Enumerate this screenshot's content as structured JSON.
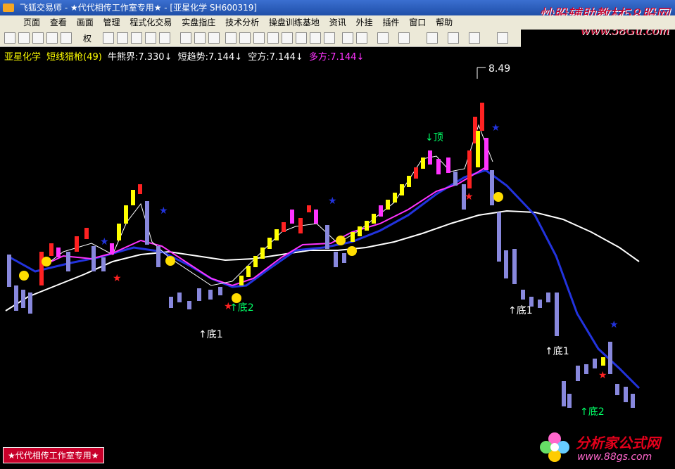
{
  "titlebar": {
    "text": "飞狐交易师 - ★代代相传工作室专用★ - [亚星化学 SH600319]"
  },
  "watermark": {
    "top": "炒股辅助教材58股网",
    "url": "www.58Gu.com"
  },
  "menu": [
    "页面",
    "查看",
    "画面",
    "管理",
    "程式化交易",
    "实盘指庄",
    "技术分析",
    "操盘训练基地",
    "资讯",
    "外挂",
    "插件",
    "窗口",
    "帮助"
  ],
  "toolbar": {
    "rights_label": "权"
  },
  "info": {
    "stock_name": "亚星化学",
    "indicator": "短线猎枪(49)",
    "bull_bear": "牛熊界:7.330↓",
    "short_trend": "短趋势:7.144↓",
    "kong": "空方:7.144↓",
    "duo": "多方:7.144↓"
  },
  "annotations": {
    "peak": "8.49",
    "top": "↓顶",
    "di1a": "↑底1",
    "di2a": "↑底2",
    "di1b": "↑底1",
    "di1c": "↑底1",
    "di2b": "↑底2"
  },
  "footer": "★代代相传工作室专用★",
  "logo": {
    "name": "分析家公式网",
    "url": "www.88gs.com"
  },
  "colors": {
    "bg": "#000000",
    "up": "#ff2222",
    "down": "#8888dd",
    "yellow": "#ffff00",
    "magenta": "#ff33ff",
    "blue": "#2233dd",
    "white": "#ffffff"
  }
}
